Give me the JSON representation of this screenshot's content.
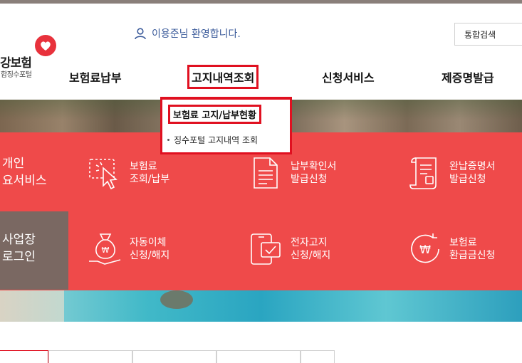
{
  "header": {
    "logo": {
      "title": "강보험",
      "subtitle": "합징수포털"
    },
    "welcome_text": "이용준님 환영합니다.",
    "search_button": "통합검색"
  },
  "gnb": {
    "items": [
      {
        "label": "보험료납부",
        "active": false
      },
      {
        "label": "고지내역조회",
        "active": true
      },
      {
        "label": "신청서비스",
        "active": false
      },
      {
        "label": "제증명발급",
        "active": false
      }
    ]
  },
  "dropdown": {
    "active_item": "보험료 고지/납부현황",
    "items": [
      "징수포털 고지내역 조회"
    ]
  },
  "banner": {
    "personal": {
      "line1": "개인",
      "line2": "요서비스"
    },
    "business": {
      "line1": "사업장",
      "line2": "로그인"
    },
    "services": [
      {
        "icon": "click-cursor-icon",
        "line1": "보험료",
        "line2": "조회/납부"
      },
      {
        "icon": "document-icon",
        "line1": "납부확인서",
        "line2": "발급신청"
      },
      {
        "icon": "certificate-scroll-icon",
        "line1": "완납증명서",
        "line2": "발급신청"
      },
      {
        "icon": "money-bag-icon",
        "line1": "자동이체",
        "line2": "신청/해지"
      },
      {
        "icon": "mobile-notice-icon",
        "line1": "전자고지",
        "line2": "신청/해지"
      },
      {
        "icon": "won-refund-icon",
        "line1": "보험료",
        "line2": "환급금신청"
      }
    ]
  },
  "colors": {
    "accent_red": "#ef4a4a",
    "highlight_border": "#e01020",
    "business_box": "#7a6862",
    "welcome_text": "#3a5a9a"
  }
}
